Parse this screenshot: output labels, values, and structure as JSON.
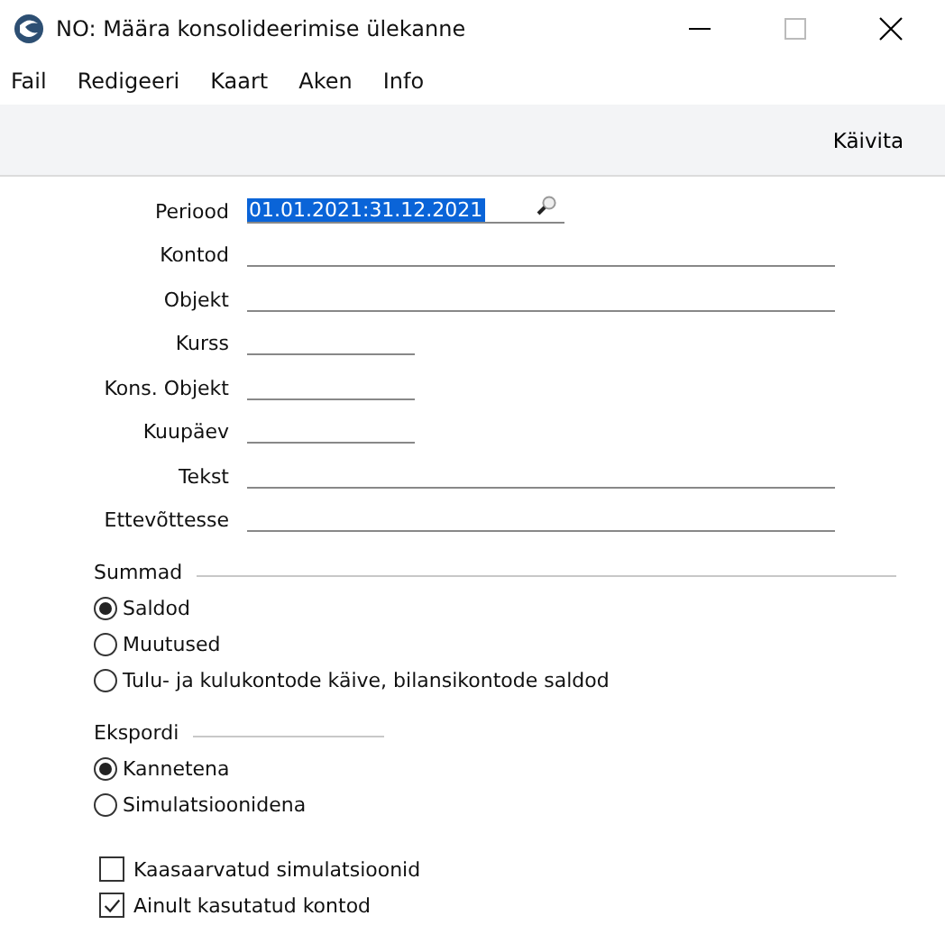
{
  "window": {
    "title": "NO: Määra konsolideerimise ülekanne"
  },
  "menu": [
    "Fail",
    "Redigeeri",
    "Kaart",
    "Aken",
    "Info"
  ],
  "toolbar": {
    "buttons": [
      "Käivita"
    ]
  },
  "fields": [
    {
      "label": "Periood",
      "kind": "period",
      "value": "01.01.2021:31.12.2021",
      "selected": true
    },
    {
      "label": "Kontod",
      "kind": "wide"
    },
    {
      "label": "Objekt",
      "kind": "wide"
    },
    {
      "label": "Kurss",
      "kind": "short"
    },
    {
      "label": "Kons. Objekt",
      "kind": "short"
    },
    {
      "label": "Kuupäev",
      "kind": "short"
    },
    {
      "label": "Tekst",
      "kind": "wide"
    },
    {
      "label": "Ettevõttesse",
      "kind": "wide"
    }
  ],
  "groups": [
    {
      "title": "Summad",
      "kind": "wide",
      "options": [
        {
          "label": "Saldod",
          "selected": true
        },
        {
          "label": "Muutused",
          "selected": false
        },
        {
          "label": "Tulu- ja kulukontode käive, bilansikontode saldod",
          "selected": false
        }
      ]
    },
    {
      "title": "Ekspordi",
      "kind": "short",
      "options": [
        {
          "label": "Kannetena",
          "selected": true
        },
        {
          "label": "Simulatsioonidena",
          "selected": false
        }
      ]
    }
  ],
  "checkboxes": [
    {
      "label": "Kaasaarvatud simulatsioonid",
      "checked": false
    },
    {
      "label": "Ainult kasutatud kontod",
      "checked": true
    }
  ]
}
